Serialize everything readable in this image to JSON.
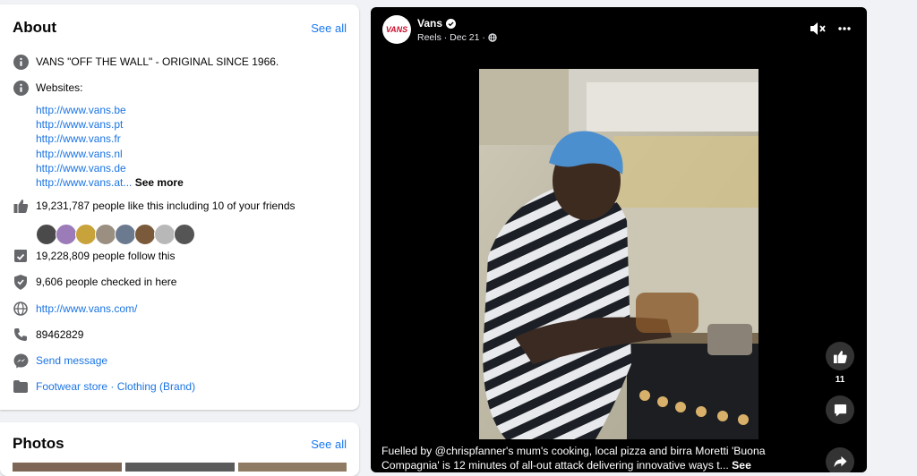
{
  "about": {
    "title": "About",
    "see_all": "See all",
    "tagline": "VANS \"OFF THE WALL\" - ORIGINAL SINCE 1966.",
    "websites_label": "Websites:",
    "websites": [
      "http://www.vans.be",
      "http://www.vans.pt",
      "http://www.vans.fr",
      "http://www.vans.nl",
      "http://www.vans.de",
      "http://www.vans.at..."
    ],
    "websites_more": "See more",
    "likes_text": "19,231,787 people like this including 10 of your friends",
    "follow_text": "19,228,809 people follow this",
    "checkin_text": "9,606 people checked in here",
    "website": "http://www.vans.com/",
    "phone": "89462829",
    "send_message": "Send message",
    "category": "Footwear store · Clothing (Brand)"
  },
  "photos": {
    "title": "Photos",
    "see_all": "See all"
  },
  "reel": {
    "page_name": "Vans",
    "logo_text": "VANS",
    "meta": "Reels · Dec 21 ·",
    "like_count": "11",
    "caption_text": "Fuelled by @chrispfanner's mum's cooking, local pizza and birra Moretti 'Buona Compagnia' is 12 minutes of all-out attack delivering innovative ways t...",
    "caption_more": "See more"
  },
  "colors": {
    "link": "#1b74e4",
    "accent": "#1877f2",
    "background": "#f0f2f5"
  },
  "icons": [
    "info-icon",
    "like-icon",
    "follow-icon",
    "checkin-icon",
    "globe-icon",
    "phone-icon",
    "messenger-icon",
    "category-icon",
    "mute-icon",
    "more-icon",
    "verified-icon",
    "globe-small-icon",
    "comment-icon",
    "share-icon"
  ]
}
